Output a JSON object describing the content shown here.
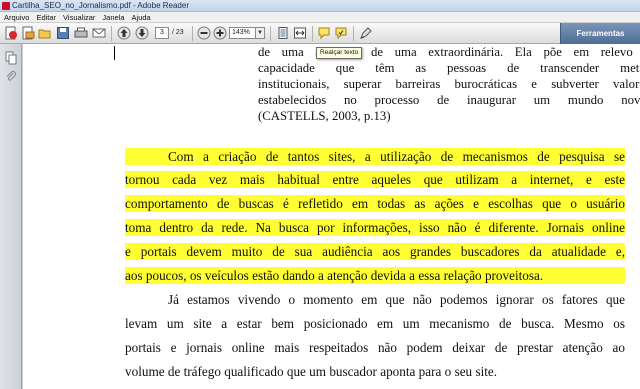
{
  "window": {
    "title": "Cartilha_SEO_no_Jornalismo.pdf - Adobe Reader"
  },
  "menu": [
    "Arquivo",
    "Editar",
    "Visualizar",
    "Janela",
    "Ajuda"
  ],
  "toolbar": {
    "current_page": "3",
    "total_pages": "/ 23",
    "zoom": "143%",
    "tools_label": "Ferramentas",
    "tooltip": "Realçar texto"
  },
  "document": {
    "quote_lines": [
      "de uma aventura de uma extraordinária. Ela põe em relevo a",
      "capacidade que têm as pessoas de transcender metas",
      "institucionais, superar barreiras burocráticas e subverter valores",
      "estabelecidos no processo de inaugurar um mundo novo.",
      "(CASTELLS, 2003, p.13)"
    ],
    "highlighted_lines": [
      "Com a criação de tantos sites, a utilização de mecanismos de pesquisa se",
      "tornou cada vez mais habitual entre aqueles que utilizam a internet, e este",
      "comportamento de buscas é refletido em todas as ações e escolhas que o usuário",
      "toma dentro da rede. Na busca por informações, isso não é diferente. Jornais online",
      "e portais devem muito de sua audiência aos grandes buscadores da atualidade e,",
      "aos poucos, os veículos estão dando a atenção devida a essa relação proveitosa."
    ],
    "paragraph_lines": [
      "Já estamos vivendo o momento em que não podemos ignorar os fatores que",
      "levam um site a estar bem posicionado em um mecanismo de busca. Mesmo os",
      "portais e jornais online mais respeitados não podem deixar de prestar atenção ao",
      "volume de tráfego qualificado que um buscador aponta para o seu site."
    ]
  },
  "colors": {
    "highlight": "#ffff33",
    "tools_panel": "#5a7aa3",
    "app_red": "#c8102e"
  }
}
